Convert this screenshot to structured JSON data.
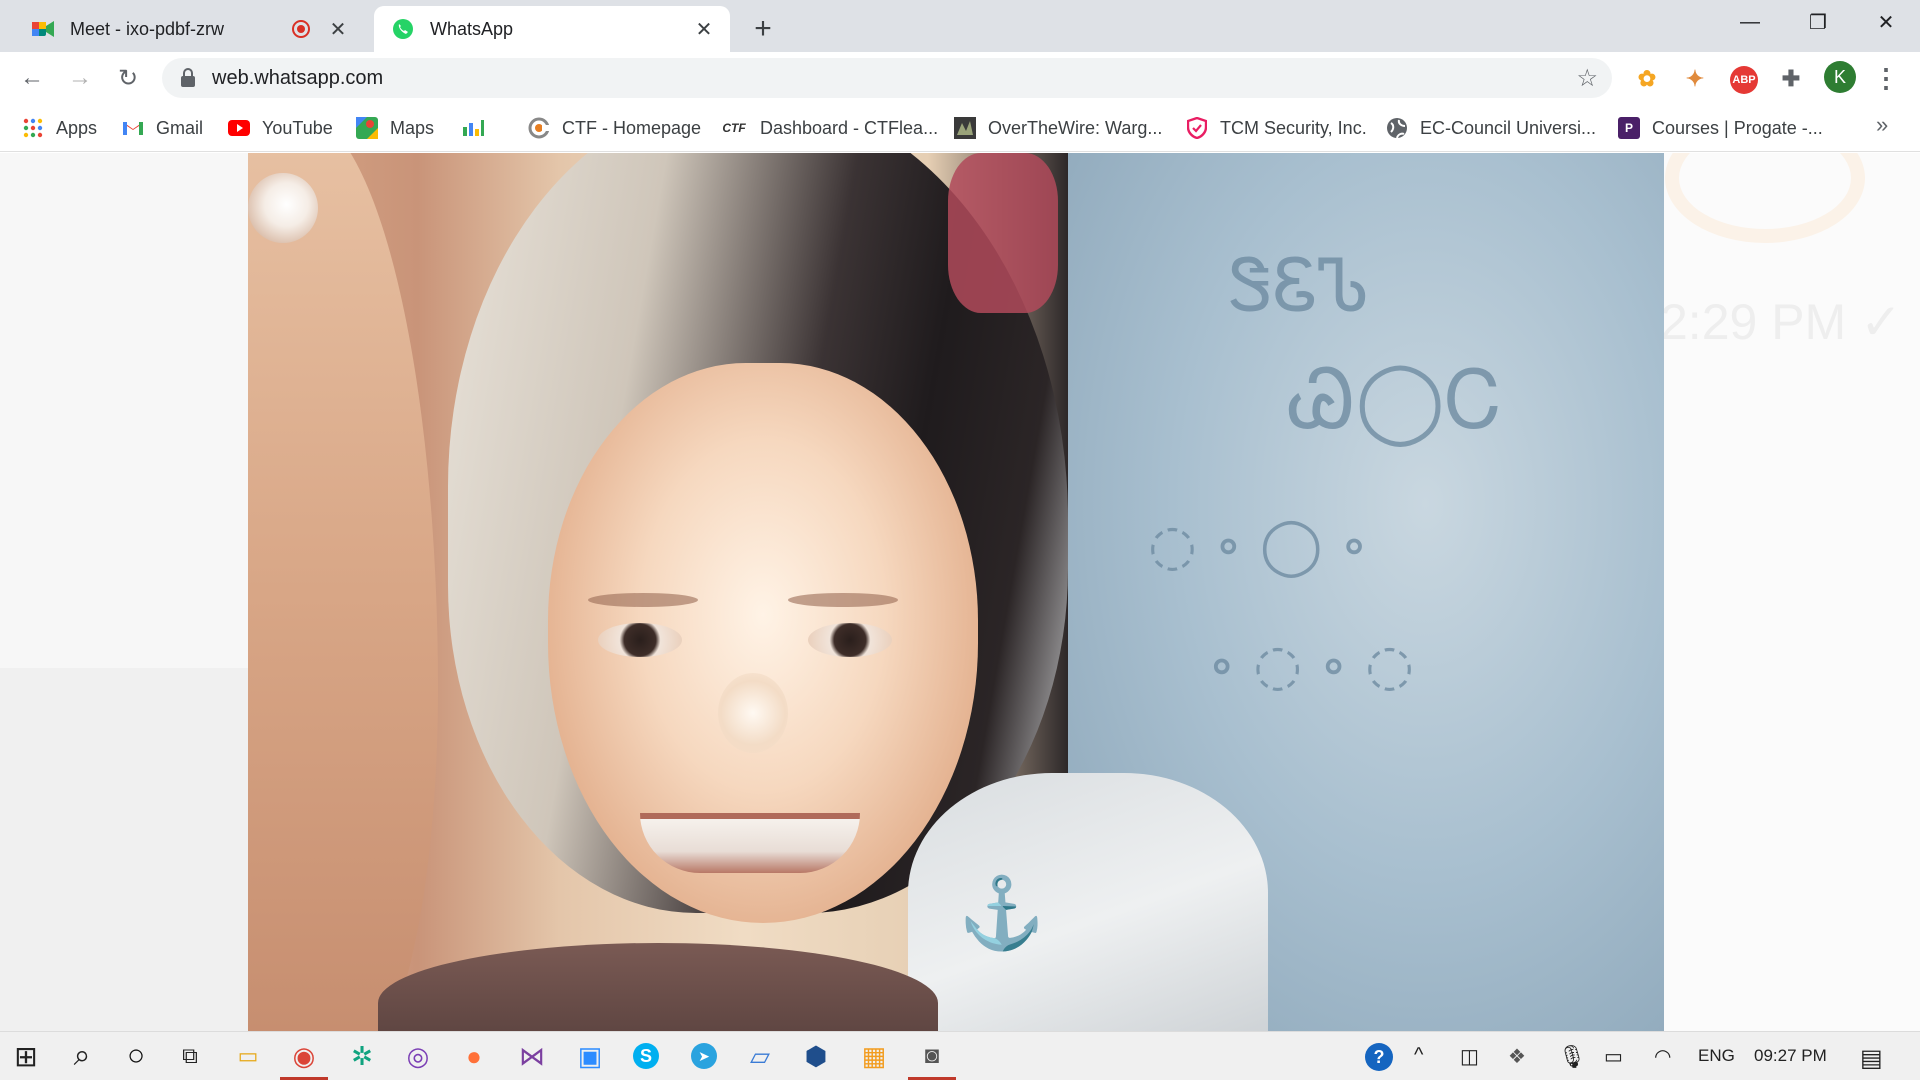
{
  "browser": {
    "tabs": [
      {
        "title": "Meet - ixo-pdbf-zrw",
        "icon": "google-meet-icon",
        "recording": true
      },
      {
        "title": "WhatsApp",
        "icon": "whatsapp-icon",
        "active": true
      }
    ],
    "new_tab_label": "+",
    "window_controls": {
      "minimize": "—",
      "restore": "❐",
      "close": "✕"
    },
    "toolbar": {
      "back": "←",
      "forward": "→",
      "reload": "↻",
      "url": "web.whatsapp.com",
      "bookmark_star": "☆",
      "extensions": [
        {
          "name": "emoji-extension-icon",
          "glyph": "✿",
          "color": "#f5a623"
        },
        {
          "name": "cookie-extension-icon",
          "glyph": "✦",
          "color": "#e08a3c"
        },
        {
          "name": "adblock-plus-icon",
          "glyph": "ABP",
          "color": "#e53935"
        },
        {
          "name": "extensions-puzzle-icon",
          "glyph": "✚",
          "color": "#5f6368"
        }
      ],
      "profile_initial": "K",
      "menu": "⋮"
    },
    "bookmarks": [
      {
        "label": "Apps",
        "icon": "apps-grid-icon"
      },
      {
        "label": "Gmail",
        "icon": "gmail-icon"
      },
      {
        "label": "YouTube",
        "icon": "youtube-icon"
      },
      {
        "label": "Maps",
        "icon": "maps-icon"
      },
      {
        "label": "",
        "icon": "analytics-icon"
      },
      {
        "label": "CTF - Homepage",
        "icon": "ctf-homepage-icon"
      },
      {
        "label": "Dashboard - CTFlea...",
        "icon": "ctf-text-icon",
        "icon_text": "CTF"
      },
      {
        "label": "OverTheWire: Warg...",
        "icon": "overthewire-icon"
      },
      {
        "label": "TCM Security, Inc.",
        "icon": "tcm-shield-icon"
      },
      {
        "label": "EC-Council Universi...",
        "icon": "globe-icon"
      },
      {
        "label": "Courses | Progate -...",
        "icon": "progate-icon",
        "icon_text": "P"
      }
    ],
    "bookmarks_more": "»"
  },
  "page": {
    "background_time": "2:29 PM ✓"
  },
  "taskbar": {
    "apps": [
      {
        "name": "windows-start-icon",
        "glyph": "⊞"
      },
      {
        "name": "search-icon",
        "glyph": "⌕"
      },
      {
        "name": "cortana-icon",
        "glyph": "○"
      },
      {
        "name": "task-view-icon",
        "glyph": "⧉"
      },
      {
        "name": "file-explorer-icon",
        "glyph": "▭"
      },
      {
        "name": "chrome-icon",
        "glyph": "◉",
        "active": true
      },
      {
        "name": "chatgpt-icon",
        "glyph": "✲"
      },
      {
        "name": "tor-browser-icon",
        "glyph": "◎"
      },
      {
        "name": "firefox-icon",
        "glyph": "●"
      },
      {
        "name": "visual-studio-icon",
        "glyph": "⋈"
      },
      {
        "name": "zoom-icon",
        "glyph": "▣"
      },
      {
        "name": "skype-icon",
        "glyph": "S"
      },
      {
        "name": "telegram-icon",
        "glyph": "➤"
      },
      {
        "name": "laptop-app-icon",
        "glyph": "▱"
      },
      {
        "name": "virtualbox-icon",
        "glyph": "⬢"
      },
      {
        "name": "vmware-icon",
        "glyph": "▦"
      },
      {
        "name": "camera-icon",
        "glyph": "◙",
        "active": true
      }
    ],
    "tray": {
      "help_icon": "?",
      "chevron": "^",
      "language": "ENG",
      "time": "09:27 PM",
      "notifications": "▤"
    }
  }
}
